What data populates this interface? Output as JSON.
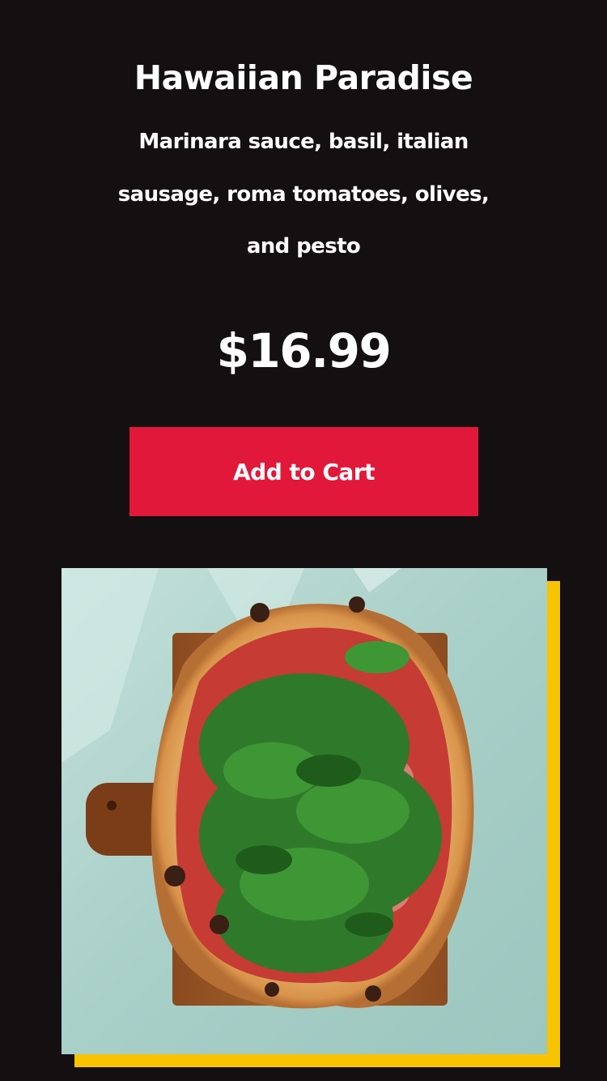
{
  "product": {
    "title": "Hawaiian Paradise",
    "description": "Marinara sauce, basil, italian sausage, roma tomatoes, olives, and pesto",
    "price": "$16.99",
    "add_to_cart_label": "Add to Cart",
    "image_alt": "pizza with arugula and prosciutto on a wooden board"
  },
  "colors": {
    "background": "#140f10",
    "button": "#e2183a",
    "accent_shadow": "#f8c300",
    "text": "#ffffff"
  }
}
